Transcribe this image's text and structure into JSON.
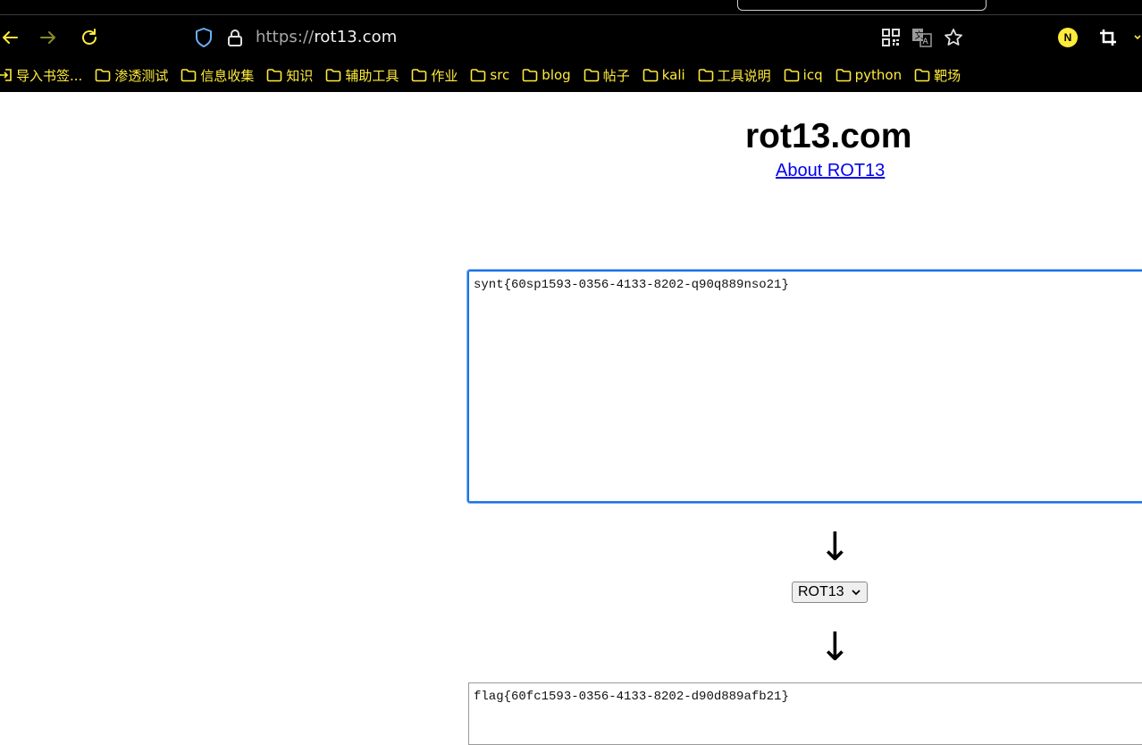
{
  "browser": {
    "url_scheme": "https://",
    "url_host": "rot13.com",
    "profile_initial": "N",
    "icons": {
      "back": "arrow-left-icon",
      "forward": "arrow-right-icon",
      "reload": "reload-icon",
      "shield": "shield-icon",
      "lock": "lock-icon",
      "qr": "qr-code-icon",
      "translate": "translate-icon",
      "star": "star-icon",
      "crop": "crop-icon"
    },
    "accent_color": "#ffeb3b"
  },
  "bookmarks": [
    {
      "label": "导入书签...",
      "icon": "import-icon"
    },
    {
      "label": "渗透测试",
      "icon": "folder-icon"
    },
    {
      "label": "信息收集",
      "icon": "folder-icon"
    },
    {
      "label": "知识",
      "icon": "folder-icon"
    },
    {
      "label": "辅助工具",
      "icon": "folder-icon"
    },
    {
      "label": "作业",
      "icon": "folder-icon"
    },
    {
      "label": "src",
      "icon": "folder-icon"
    },
    {
      "label": "blog",
      "icon": "folder-icon"
    },
    {
      "label": "帖子",
      "icon": "folder-icon"
    },
    {
      "label": "kali",
      "icon": "folder-icon"
    },
    {
      "label": "工具说明",
      "icon": "folder-icon"
    },
    {
      "label": "icq",
      "icon": "folder-icon"
    },
    {
      "label": "python",
      "icon": "folder-icon"
    },
    {
      "label": "靶场",
      "icon": "folder-icon"
    }
  ],
  "page": {
    "title": "rot13.com",
    "about_link": "About ROT13",
    "input_text": "synt{60sp1593-0356-4133-8202-q90q889nso21}",
    "arrow_glyph": "↓",
    "cipher_selected": "ROT13",
    "output_text": "flag{60fc1593-0356-4133-8202-d90d889afb21}"
  }
}
